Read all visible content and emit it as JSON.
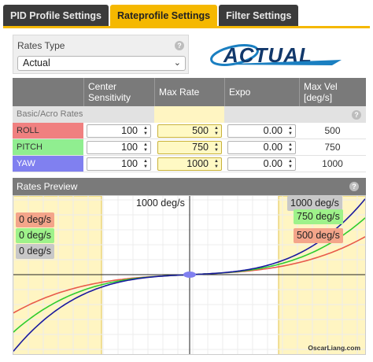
{
  "tabs": [
    {
      "label": "PID Profile Settings"
    },
    {
      "label": "Rateprofile Settings"
    },
    {
      "label": "Filter Settings"
    }
  ],
  "rates_type": {
    "label": "Rates Type",
    "value": "Actual",
    "help": "?"
  },
  "logo_text": "ACTUAL",
  "table": {
    "headers": [
      "Center Sensitivity",
      "Max Rate",
      "Expo",
      "Max Vel [deg/s]"
    ],
    "section": "Basic/Acro Rates",
    "rows": [
      {
        "axis": "ROLL",
        "center": "100",
        "max_rate": "500",
        "expo": "0.00",
        "max_vel": "500"
      },
      {
        "axis": "PITCH",
        "center": "100",
        "max_rate": "750",
        "expo": "0.00",
        "max_vel": "750"
      },
      {
        "axis": "YAW",
        "center": "100",
        "max_rate": "1000",
        "expo": "0.00",
        "max_vel": "1000"
      }
    ]
  },
  "preview": {
    "title": "Rates Preview",
    "y_axis_label": "1000 deg/s",
    "left_labels": [
      "0 deg/s",
      "0 deg/s",
      "0 deg/s"
    ],
    "right_labels": [
      "1000 deg/s",
      "750 deg/s",
      "500 deg/s"
    ],
    "watermark": "OscarLiang.com"
  },
  "colors": {
    "accent": "#f5b800",
    "roll": "#f08080",
    "pitch": "#90ee90",
    "yaw": "#8080f0"
  }
}
